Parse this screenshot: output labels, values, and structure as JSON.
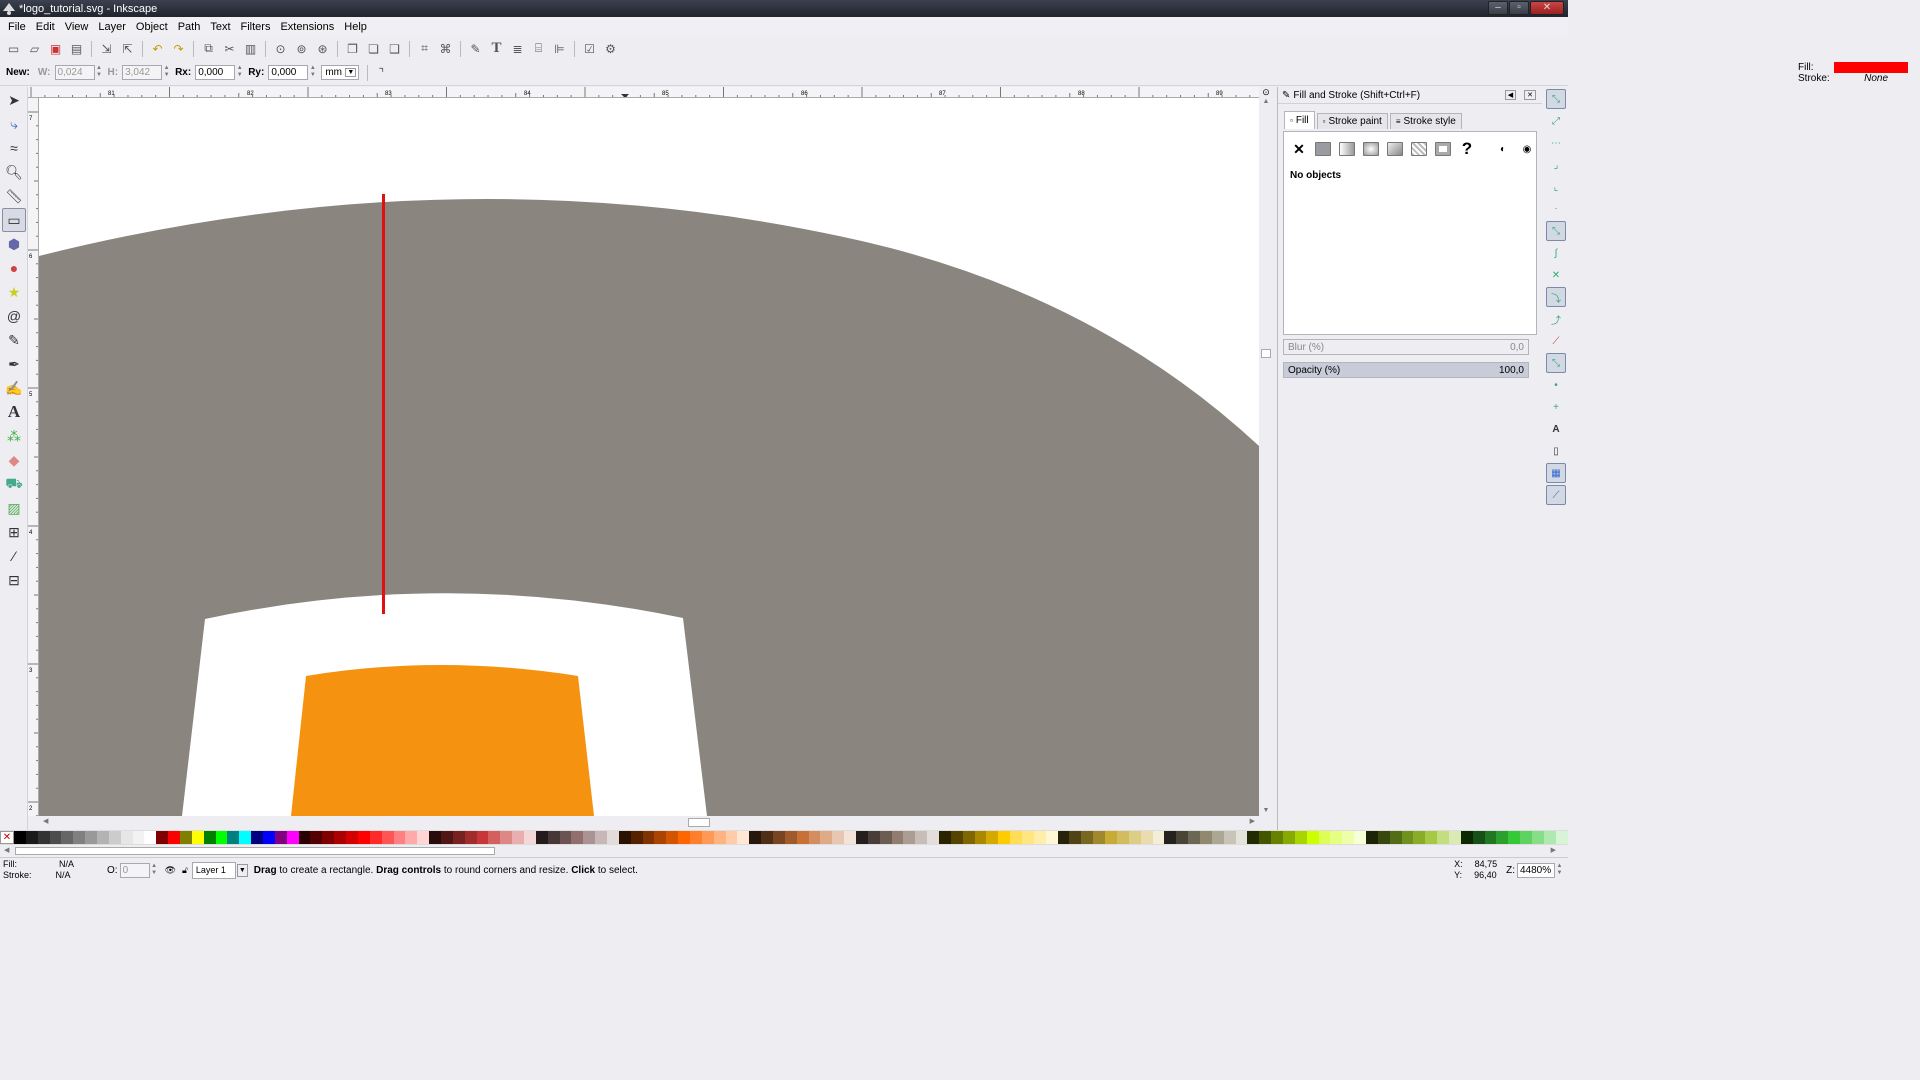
{
  "window": {
    "title": "*logo_tutorial.svg - Inkscape"
  },
  "menu": [
    "File",
    "Edit",
    "View",
    "Layer",
    "Object",
    "Path",
    "Text",
    "Filters",
    "Extensions",
    "Help"
  ],
  "controls": {
    "new_label": "New:",
    "w_label": "W:",
    "w_value": "0,024",
    "h_label": "H:",
    "h_value": "3,042",
    "rx_label": "Rx:",
    "rx_value": "0,000",
    "ry_label": "Ry:",
    "ry_value": "0,000",
    "unit": "mm"
  },
  "style_indicator": {
    "fill_label": "Fill:",
    "fill_color": "#ff0000",
    "stroke_label": "Stroke:",
    "stroke_value": "None"
  },
  "rulers": {
    "h_ticks": [
      "81",
      "82",
      "83",
      "84",
      "85",
      "86",
      "87",
      "88",
      "89"
    ],
    "v_ticks": [
      "7",
      "6",
      "5",
      "4",
      "3",
      "2"
    ]
  },
  "panel": {
    "title": "Fill and Stroke (Shift+Ctrl+F)",
    "tabs": [
      "Fill",
      "Stroke paint",
      "Stroke style"
    ],
    "no_objects": "No objects",
    "blur_label": "Blur (%)",
    "blur_value": "0,0",
    "opacity_label": "Opacity (%)",
    "opacity_value": "100,0"
  },
  "canvas": {
    "colors": {
      "grey": "#8a857f",
      "orange": "#f5920f",
      "red_line": "#e01010",
      "white": "#ffffff"
    }
  },
  "palette": [
    "#000000",
    "#1a1a1a",
    "#333333",
    "#4d4d4d",
    "#666666",
    "#808080",
    "#999999",
    "#b3b3b3",
    "#cccccc",
    "#e6e6e6",
    "#f2f2f2",
    "#ffffff",
    "#800000",
    "#ff0000",
    "#808000",
    "#ffff00",
    "#008000",
    "#00ff00",
    "#008080",
    "#00ffff",
    "#000080",
    "#0000ff",
    "#800080",
    "#ff00ff",
    "#2b0000",
    "#550000",
    "#800000",
    "#aa0000",
    "#d40000",
    "#ff0000",
    "#ff2a2a",
    "#ff5555",
    "#ff8080",
    "#ffaaaa",
    "#ffd5d5",
    "#280b0b",
    "#501616",
    "#782121",
    "#a02c2c",
    "#c83737",
    "#d35f5f",
    "#de8787",
    "#e9afaf",
    "#f4d7d7",
    "#241c1c",
    "#483737",
    "#6c5353",
    "#916f6f",
    "#ac9393",
    "#c8b7b7",
    "#e3dbdb",
    "#2b1100",
    "#552200",
    "#803300",
    "#aa4400",
    "#d45500",
    "#ff6600",
    "#ff7f2a",
    "#ff9955",
    "#ffb380",
    "#ffccaa",
    "#ffe6d5",
    "#28170b",
    "#502d16",
    "#784421",
    "#a05a2c",
    "#c87137",
    "#d38d5f",
    "#deaa87",
    "#e9c6af",
    "#f4e3d7",
    "#241f1c",
    "#483e37",
    "#6c5d53",
    "#917c6f",
    "#ac9d93",
    "#c8beb7",
    "#e3dedb",
    "#2b2200",
    "#554400",
    "#806600",
    "#aa8800",
    "#d4aa00",
    "#ffcc00",
    "#ffdd55",
    "#ffe680",
    "#ffeeaa",
    "#fff6d5",
    "#28220b",
    "#504416",
    "#786721",
    "#a0892c",
    "#c8ab37",
    "#d3bc5f",
    "#decd87",
    "#e9ddaf",
    "#f4eed7",
    "#24221c",
    "#484537",
    "#6c6753",
    "#91896f",
    "#aca793",
    "#c8c4b7",
    "#e3e2db",
    "#222b00",
    "#445500",
    "#668000",
    "#88aa00",
    "#aad400",
    "#ccff00",
    "#ddff55",
    "#e5ff80",
    "#eeffaa",
    "#f6ffd5",
    "#1c2408",
    "#37480f",
    "#536c16",
    "#6f911d",
    "#89ac29",
    "#a5c845",
    "#c4dd7e",
    "#dbeab4",
    "#0b2800",
    "#165016",
    "#217821",
    "#2ca02c",
    "#37c837",
    "#5fd35f",
    "#87de87",
    "#afe9af",
    "#d7f4d7"
  ],
  "status": {
    "fill_label": "Fill:",
    "fill_value": "N/A",
    "stroke_label": "Stroke:",
    "stroke_value": "N/A",
    "opacity_label": "O:",
    "opacity_value": "0",
    "layer": "Layer 1",
    "msg_b1": "Drag",
    "msg_t1": " to create a rectangle. ",
    "msg_b2": "Drag controls",
    "msg_t2": " to round corners and resize. ",
    "msg_b3": "Click",
    "msg_t3": " to select.",
    "x_label": "X:",
    "x_value": "84,75",
    "y_label": "Y:",
    "y_value": "96,40",
    "zoom_label": "Z:",
    "zoom_value": "4480%"
  }
}
